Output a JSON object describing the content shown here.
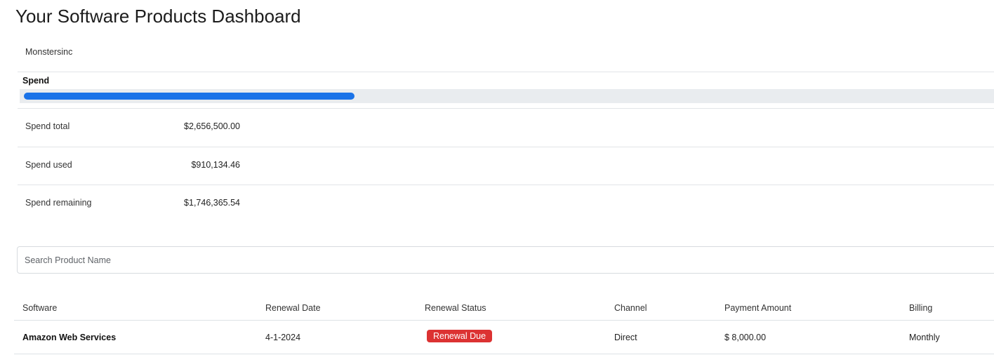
{
  "page": {
    "title": "Your Software Products Dashboard",
    "organization": "Monstersinc"
  },
  "spend": {
    "title": "Spend",
    "progress_fraction": 0.3426,
    "accent_color": "#1a73e8",
    "rows": [
      {
        "label": "Spend total",
        "value": "$2,656,500.00"
      },
      {
        "label": "Spend used",
        "value": "$910,134.46"
      },
      {
        "label": "Spend remaining",
        "value": "$1,746,365.54"
      }
    ]
  },
  "search": {
    "placeholder": "Search Product Name",
    "value": ""
  },
  "table": {
    "columns": [
      "Software",
      "Renewal Date",
      "Renewal Status",
      "Channel",
      "Payment Amount",
      "Billing"
    ],
    "rows": [
      {
        "software": "Amazon Web Services",
        "renewal_date": "4-1-2024",
        "renewal_status": "Renewal Due",
        "status_color": "#dc3232",
        "channel": "Direct",
        "payment_amount": "$ 8,000.00",
        "billing": "Monthly"
      }
    ]
  }
}
